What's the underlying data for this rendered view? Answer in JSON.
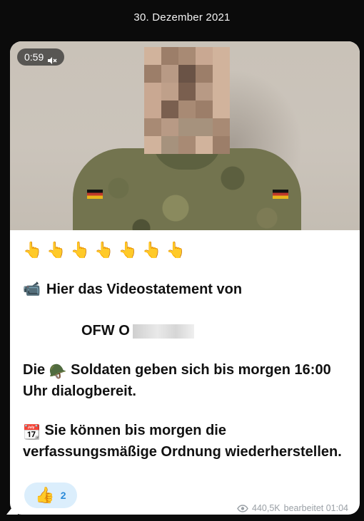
{
  "header": {
    "date": "30. Dezember 2021"
  },
  "video": {
    "duration": "0:59",
    "muted_icon": "speaker-muted-icon"
  },
  "message": {
    "pointing_emojis": [
      "👆",
      "👆",
      "👆",
      "👆",
      "👆",
      "👆",
      "👆"
    ],
    "video_emoji": "📹",
    "line1": "Hier das Videostatement von",
    "rank_name": "OFW O",
    "helmet_emoji": "🪖",
    "para1_a": "Die",
    "para1_b": "Soldaten geben sich bis morgen 16:00 Uhr dialogbereit.",
    "calendar_emoji": "📆",
    "para2": "Sie können bis morgen die verfassungsmäßige Ordnung wiederherstellen."
  },
  "reaction": {
    "emoji": "👍",
    "count": "2"
  },
  "footer": {
    "views": "440,5K",
    "edited": "bearbeitet 01:04"
  }
}
